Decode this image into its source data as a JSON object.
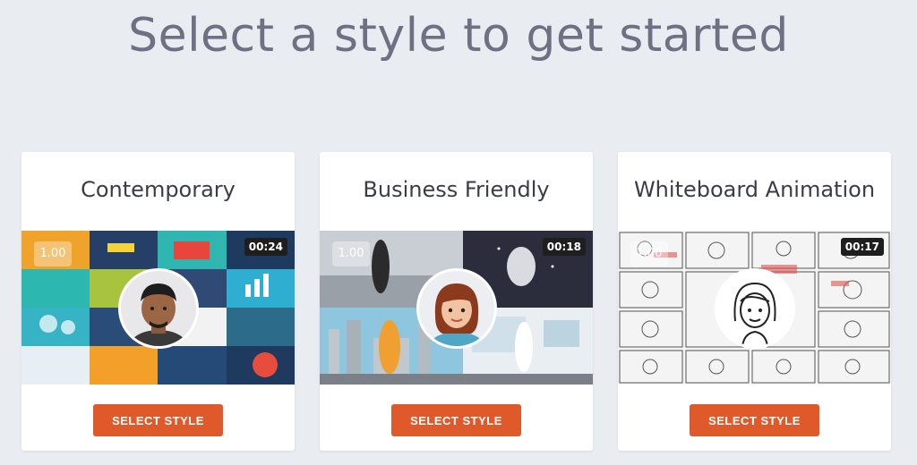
{
  "page": {
    "title": "Select a style to get started"
  },
  "styles": [
    {
      "name": "Contemporary",
      "rate": "1.00",
      "duration": "00:24",
      "button_label": "SELECT STYLE"
    },
    {
      "name": "Business Friendly",
      "rate": "1.00",
      "duration": "00:18",
      "button_label": "SELECT STYLE"
    },
    {
      "name": "Whiteboard Animation",
      "rate": "1.00",
      "duration": "00:17",
      "button_label": "SELECT STYLE"
    }
  ],
  "colors": {
    "background": "#e9ecf1",
    "accent": "#e0592b",
    "title_text": "#6d7183"
  },
  "icons": {
    "avatar_contemporary": "man-avatar-icon",
    "avatar_business": "woman-avatar-icon",
    "avatar_whiteboard": "sketch-woman-avatar-icon"
  }
}
